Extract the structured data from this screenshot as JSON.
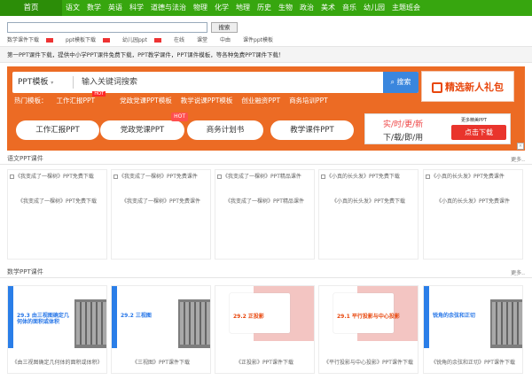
{
  "nav": {
    "home": "首页",
    "items": [
      "语文",
      "数学",
      "英语",
      "科学",
      "道德与法治",
      "物理",
      "化学",
      "地理",
      "历史",
      "生物",
      "政治",
      "美术",
      "音乐",
      "幼儿园",
      "主题班会"
    ]
  },
  "search": {
    "placeholder": "",
    "button": "搜索"
  },
  "tags": [
    "数学课件下载",
    "ppt模板下载",
    "幼儿园ppt",
    "在线",
    "课堂",
    "中由",
    "课件ppt模板"
  ],
  "intro": "第一PPT课件下载，提供中小学PPT课件免费下载，PPT教学课件，PPT课件模板，等各种免费PPT课件下载！",
  "banner": {
    "select": "PPT模板",
    "keyword": "输入关键词搜索",
    "search_btn": "搜索",
    "gift": "精选新人礼包",
    "hot_prefix": "热门模板：",
    "hot": [
      "工作汇报PPT",
      "党政党课PPT模板",
      "教学说课PPT模板",
      "创业融资PPT",
      "商务培训PPT"
    ],
    "hot_badge": "HOT",
    "pills": [
      "工作汇报PPT",
      "党政党课PPT",
      "商务计划书",
      "教学课件PPT"
    ],
    "pill_badge": "HOT",
    "promo_l1": "实/时/更/新",
    "promo_l2": "下/载/即/用",
    "promo_small": "更多精美PPT",
    "promo_btn": "点击下载"
  },
  "sections": [
    {
      "title": "语文PPT课件",
      "more": "更多..",
      "cards": [
        {
          "alt": "《我变成了一棵树》PPT免费下载",
          "caption": "《我变成了一棵树》PPT免费下载"
        },
        {
          "alt": "《我变成了一棵树》PPT免费课件",
          "caption": "《我变成了一棵树》PPT免费课件"
        },
        {
          "alt": "《我变成了一棵树》PPT精品课件",
          "caption": "《我变成了一棵树》PPT精品课件"
        },
        {
          "alt": "《小真的长头发》PPT免费下载",
          "caption": "《小真的长头发》PPT免费下载"
        },
        {
          "alt": "《小真的长头发》PPT免费课件",
          "caption": "《小真的长头发》PPT免费课件"
        }
      ]
    },
    {
      "title": "数学PPT课件",
      "more": "更多..",
      "cards": [
        {
          "slide_title": "29.3 由三视图确定几何体的面积或体积",
          "caption": "《由三视图确定几何体的面积或体积》"
        },
        {
          "slide_title": "29.2 三视图",
          "caption": "《三视图》PPT课件下载"
        },
        {
          "slide_title": "29.2 正投影",
          "caption": "《正投影》PPT课件下载"
        },
        {
          "slide_title": "29.1 平行投影与中心投影",
          "caption": "《平行投影与中心投影》PPT课件下载"
        },
        {
          "slide_title": "锐角的余弦和正切",
          "caption": "《锐角的余弦和正切》PPT课件下载"
        }
      ]
    }
  ],
  "colors": {
    "nav": "#37a60f",
    "banner": "#ec6b24",
    "accent": "#e8470d",
    "blue": "#2a7ee8"
  }
}
